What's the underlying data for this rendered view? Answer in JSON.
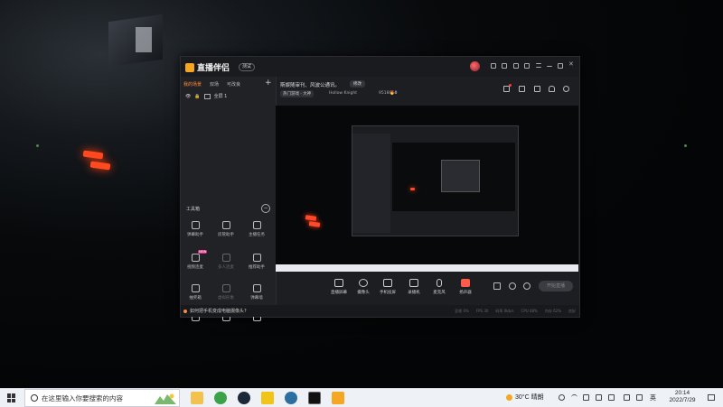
{
  "app": {
    "name": "直播伴侣",
    "version_badge": "测试",
    "left_tabs": [
      "我的场景",
      "双场",
      "可改良"
    ],
    "scene": {
      "label": "全屏 1"
    },
    "toolbox": {
      "title": "工具箱",
      "tools": [
        {
          "label": "弹幕助手",
          "icon": "danmaku-icon",
          "enabled": true
        },
        {
          "label": "房管助手",
          "icon": "admin-icon",
          "enabled": true
        },
        {
          "label": "主播任务",
          "icon": "task-icon",
          "enabled": true
        },
        {
          "label": "视频连麦",
          "icon": "video-link-icon",
          "enabled": true,
          "badge": "NEW"
        },
        {
          "label": "多人连麦",
          "icon": "multi-link-icon",
          "enabled": false
        },
        {
          "label": "推荐助手",
          "icon": "recommend-icon",
          "enabled": true
        },
        {
          "label": "抽奖箱",
          "icon": "lottery-icon",
          "enabled": true
        },
        {
          "label": "虚拟形象",
          "icon": "avatar-icon",
          "enabled": false
        },
        {
          "label": "弹幕墙",
          "icon": "danmaku-wall-icon",
          "enabled": true
        },
        {
          "label": "",
          "icon": "screen-icon",
          "enabled": true
        },
        {
          "label": "",
          "icon": "gift-icon",
          "enabled": true,
          "badge": "NEW"
        },
        {
          "label": "",
          "icon": "upload-icon",
          "enabled": true
        }
      ]
    },
    "header": {
      "announcement": "斯娱随审刊、风波公通讯。",
      "edit_label": "修改",
      "category": "热门游戏 · 大神",
      "game": "Hollow Knight",
      "room_id": "9518654",
      "heat": "0"
    },
    "controls": [
      {
        "label": "直播屏幕",
        "icon": "screen-share-icon"
      },
      {
        "label": "摄像头",
        "icon": "camera-icon"
      },
      {
        "label": "手机投屏",
        "icon": "phone-cast-icon"
      },
      {
        "label": "录播机",
        "icon": "recorder-icon"
      },
      {
        "label": "麦克风",
        "icon": "microphone-icon"
      },
      {
        "label": "扬声器",
        "icon": "speaker-icon"
      }
    ],
    "start_live_label": "开始直播",
    "statusbar": {
      "help": "如何把手机变成电脑摄像头?",
      "stats": [
        "丢帧 0%",
        "FPS 30",
        "码率 0kb/s",
        "CPU 48%",
        "内存 62%",
        "良好"
      ]
    }
  },
  "taskbar": {
    "search_placeholder": "在这里输入你要搜索的内容",
    "weather": "30°C 晴朗",
    "time": "20:14",
    "date": "2022/7/29",
    "ime": "英"
  },
  "colors": {
    "accent": "#ff8a3d",
    "brand": "#f5a623",
    "red": "#ff5a4a"
  }
}
